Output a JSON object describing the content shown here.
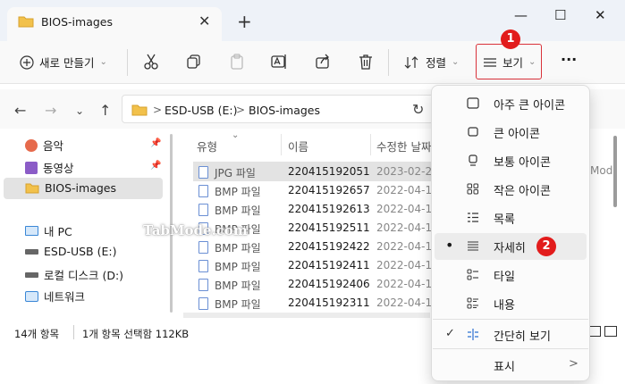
{
  "window": {
    "tab_title": "BIOS-images",
    "tab_close": "✕",
    "tab_new": "+",
    "min": "—",
    "max": "☐",
    "close": "✕"
  },
  "toolbar": {
    "new_label": "새로 만들기",
    "sort_label": "정렬",
    "view_label": "보기",
    "more": "···",
    "badge_view": "1"
  },
  "address": {
    "drive": "ESD-USB (E:)",
    "folder": "BIOS-images",
    "sep": ">"
  },
  "sidebar": {
    "items": [
      {
        "label": "음악"
      },
      {
        "label": "동영상"
      },
      {
        "label": "BIOS-images"
      },
      {
        "label": "내 PC"
      },
      {
        "label": "ESD-USB (E:)"
      },
      {
        "label": "로컬 디스크 (D:)"
      },
      {
        "label": "네트워크"
      }
    ]
  },
  "columns": {
    "type": "유형",
    "name": "이름",
    "modified": "수정한 날짜",
    "extra": "Mod"
  },
  "files": [
    {
      "type": "JPG 파일",
      "name": "220415192051",
      "date": "2023-02-2"
    },
    {
      "type": "BMP 파일",
      "name": "220415192657",
      "date": "2022-04-1"
    },
    {
      "type": "BMP 파일",
      "name": "220415192613",
      "date": "2022-04-1"
    },
    {
      "type": "BMP 파일",
      "name": "220415192511",
      "date": "2022-04-1"
    },
    {
      "type": "BMP 파일",
      "name": "220415192422",
      "date": "2022-04-1"
    },
    {
      "type": "BMP 파일",
      "name": "220415192411",
      "date": "2022-04-1"
    },
    {
      "type": "BMP 파일",
      "name": "220415192406",
      "date": "2022-04-1"
    },
    {
      "type": "BMP 파일",
      "name": "220415192311",
      "date": "2022-04-1"
    }
  ],
  "status": {
    "count": "14개 항목",
    "selection": "1개 항목 선택함 112KB"
  },
  "view_menu": {
    "items": [
      {
        "label": "아주 큰 아이콘",
        "icon": "square-icon"
      },
      {
        "label": "큰 아이콘",
        "icon": "square-icon"
      },
      {
        "label": "보통 아이콘",
        "icon": "monitor-icon"
      },
      {
        "label": "작은 아이콘",
        "icon": "small-icons-icon"
      },
      {
        "label": "목록",
        "icon": "list-icon"
      },
      {
        "label": "자세히",
        "icon": "details-icon"
      },
      {
        "label": "타일",
        "icon": "tiles-icon"
      },
      {
        "label": "내용",
        "icon": "content-icon"
      },
      {
        "label": "간단히 보기",
        "icon": "compact-icon"
      },
      {
        "label": "표시",
        "icon": "chevron-right-icon"
      }
    ],
    "selected_bullet": "•",
    "check": "✓",
    "badge_details": "2",
    "submenu_arrow": ">"
  },
  "watermark": "TabMode.com",
  "colors": {
    "accent_red": "#d9323a",
    "badge_red": "#e21c1c",
    "folder_yellow": "#f2c14b"
  }
}
